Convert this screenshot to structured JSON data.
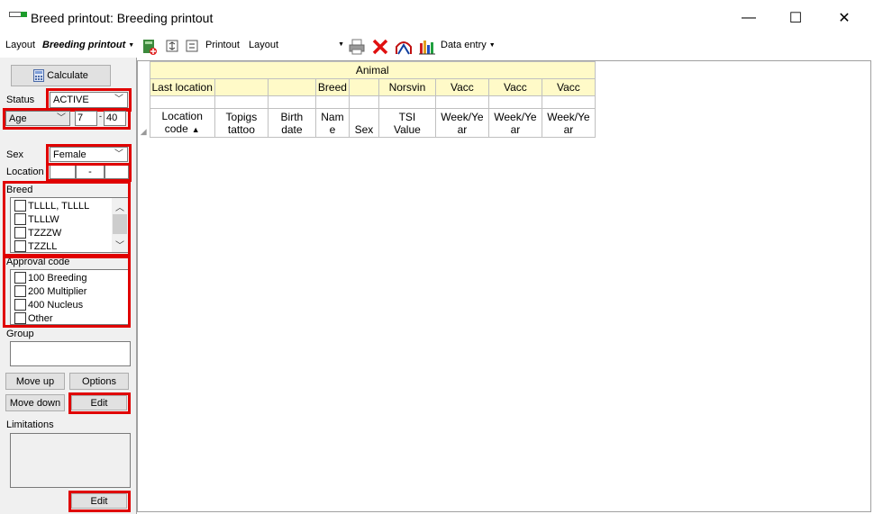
{
  "window": {
    "title": "Breed printout: Breeding printout",
    "minimize": "—",
    "maximize": "☐",
    "close": "✕"
  },
  "toolbar": {
    "layout_label": "Layout",
    "layout_value": "Breeding printout",
    "printout_label": "Printout",
    "printout_layout": "Layout",
    "data_entry": "Data entry"
  },
  "left": {
    "calculate": "Calculate",
    "status_label": "Status",
    "status_value": "ACTIVE",
    "age_field": "Age",
    "age_from": "7",
    "age_sep": "-",
    "age_to": "40",
    "sex_label": "Sex",
    "sex_value": "Female",
    "location_label": "Location",
    "location_sep": "-",
    "breed_label": "Breed",
    "breed_items": [
      "TLLLL, TLLLL",
      "TLLLW",
      "TZZZW",
      "TZZLL"
    ],
    "approval_label": "Approval code",
    "approval_items": [
      "100 Breeding",
      "200 Multiplier",
      "400 Nucleus",
      "Other"
    ],
    "group_label": "Group",
    "move_up": "Move up",
    "options": "Options",
    "move_down": "Move down",
    "edit": "Edit",
    "limitations_label": "Limitations",
    "edit2": "Edit"
  },
  "grid": {
    "group_header": "Animal",
    "row2": [
      "Last location",
      "",
      "",
      "Breed",
      "",
      "Norsvin",
      "Vacc",
      "Vacc",
      "Vacc"
    ],
    "columns": [
      {
        "line1": "Location",
        "line2": "code"
      },
      {
        "line1": "Topigs",
        "line2": "tattoo"
      },
      {
        "line1": "Birth",
        "line2": "date"
      },
      {
        "line1": "Nam",
        "line2": "e"
      },
      {
        "line1": "",
        "line2": "Sex"
      },
      {
        "line1": "TSI",
        "line2": "Value"
      },
      {
        "line1": "Week/Ye",
        "line2": "ar"
      },
      {
        "line1": "Week/Ye",
        "line2": "ar"
      },
      {
        "line1": "Week/Ye",
        "line2": "ar"
      }
    ],
    "sort_arrow": "▲"
  },
  "colors": {
    "highlight": "#e00000",
    "header_yellow": "#fffac8"
  }
}
